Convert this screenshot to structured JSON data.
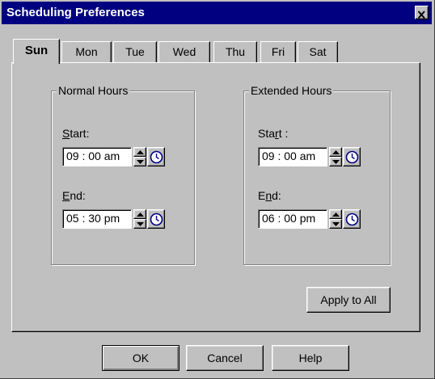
{
  "window": {
    "title": "Scheduling Preferences"
  },
  "tabs": [
    {
      "label": "Sun",
      "active": true
    },
    {
      "label": "Mon"
    },
    {
      "label": "Tue"
    },
    {
      "label": "Wed"
    },
    {
      "label": "Thu"
    },
    {
      "label": "Fri"
    },
    {
      "label": "Sat"
    }
  ],
  "normal_hours": {
    "title": "Normal Hours",
    "start_label": "Start:",
    "start_value": "09 : 00  am",
    "end_label": "End:",
    "end_value": "05 : 30  pm"
  },
  "extended_hours": {
    "title": "Extended Hours",
    "start_label": "Start :",
    "start_value": "09 : 00  am",
    "end_label": "End:",
    "end_value": "06 : 00  pm"
  },
  "buttons": {
    "apply_all": "Apply to All",
    "ok": "OK",
    "cancel": "Cancel",
    "help": "Help"
  },
  "icons": [
    "close-icon",
    "spin-up-icon",
    "spin-down-icon",
    "clock-icon"
  ],
  "colors": {
    "titlebar": "#000080",
    "face": "#c0c0c0",
    "clock": "#000080"
  }
}
